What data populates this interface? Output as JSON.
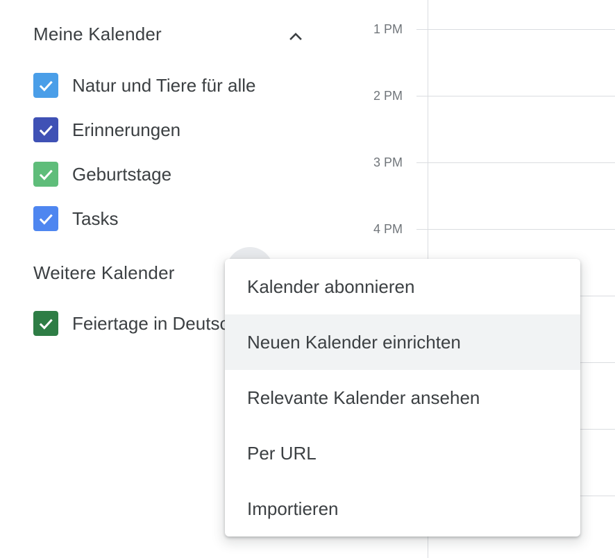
{
  "my_calendars": {
    "title": "Meine Kalender",
    "toggle_icon": "chevron-up-icon",
    "items": [
      {
        "label": "Natur und Tiere für alle",
        "color": "#4a9ee8",
        "checked": true
      },
      {
        "label": "Erinnerungen",
        "color": "#3f51b5",
        "checked": true
      },
      {
        "label": "Geburtstage",
        "color": "#5fbd7a",
        "checked": true
      },
      {
        "label": "Tasks",
        "color": "#4e86f0",
        "checked": true
      }
    ]
  },
  "other_calendars": {
    "title": "Weitere Kalender",
    "items": [
      {
        "label": "Feiertage in Deutschland",
        "color": "#2e7d45",
        "checked": true
      }
    ]
  },
  "time_grid": {
    "labels": [
      "1 PM",
      "2 PM",
      "3 PM",
      "4 PM"
    ]
  },
  "add_menu": {
    "items": [
      {
        "label": "Kalender abonnieren",
        "highlighted": false
      },
      {
        "label": "Neuen Kalender einrichten",
        "highlighted": true
      },
      {
        "label": "Relevante Kalender ansehen",
        "highlighted": false
      },
      {
        "label": "Per URL",
        "highlighted": false
      },
      {
        "label": "Importieren",
        "highlighted": false
      }
    ]
  },
  "colors": {
    "text": "#3c4043",
    "muted": "#70757a",
    "grid": "#dadce0",
    "menu_hover": "#f1f3f4"
  }
}
